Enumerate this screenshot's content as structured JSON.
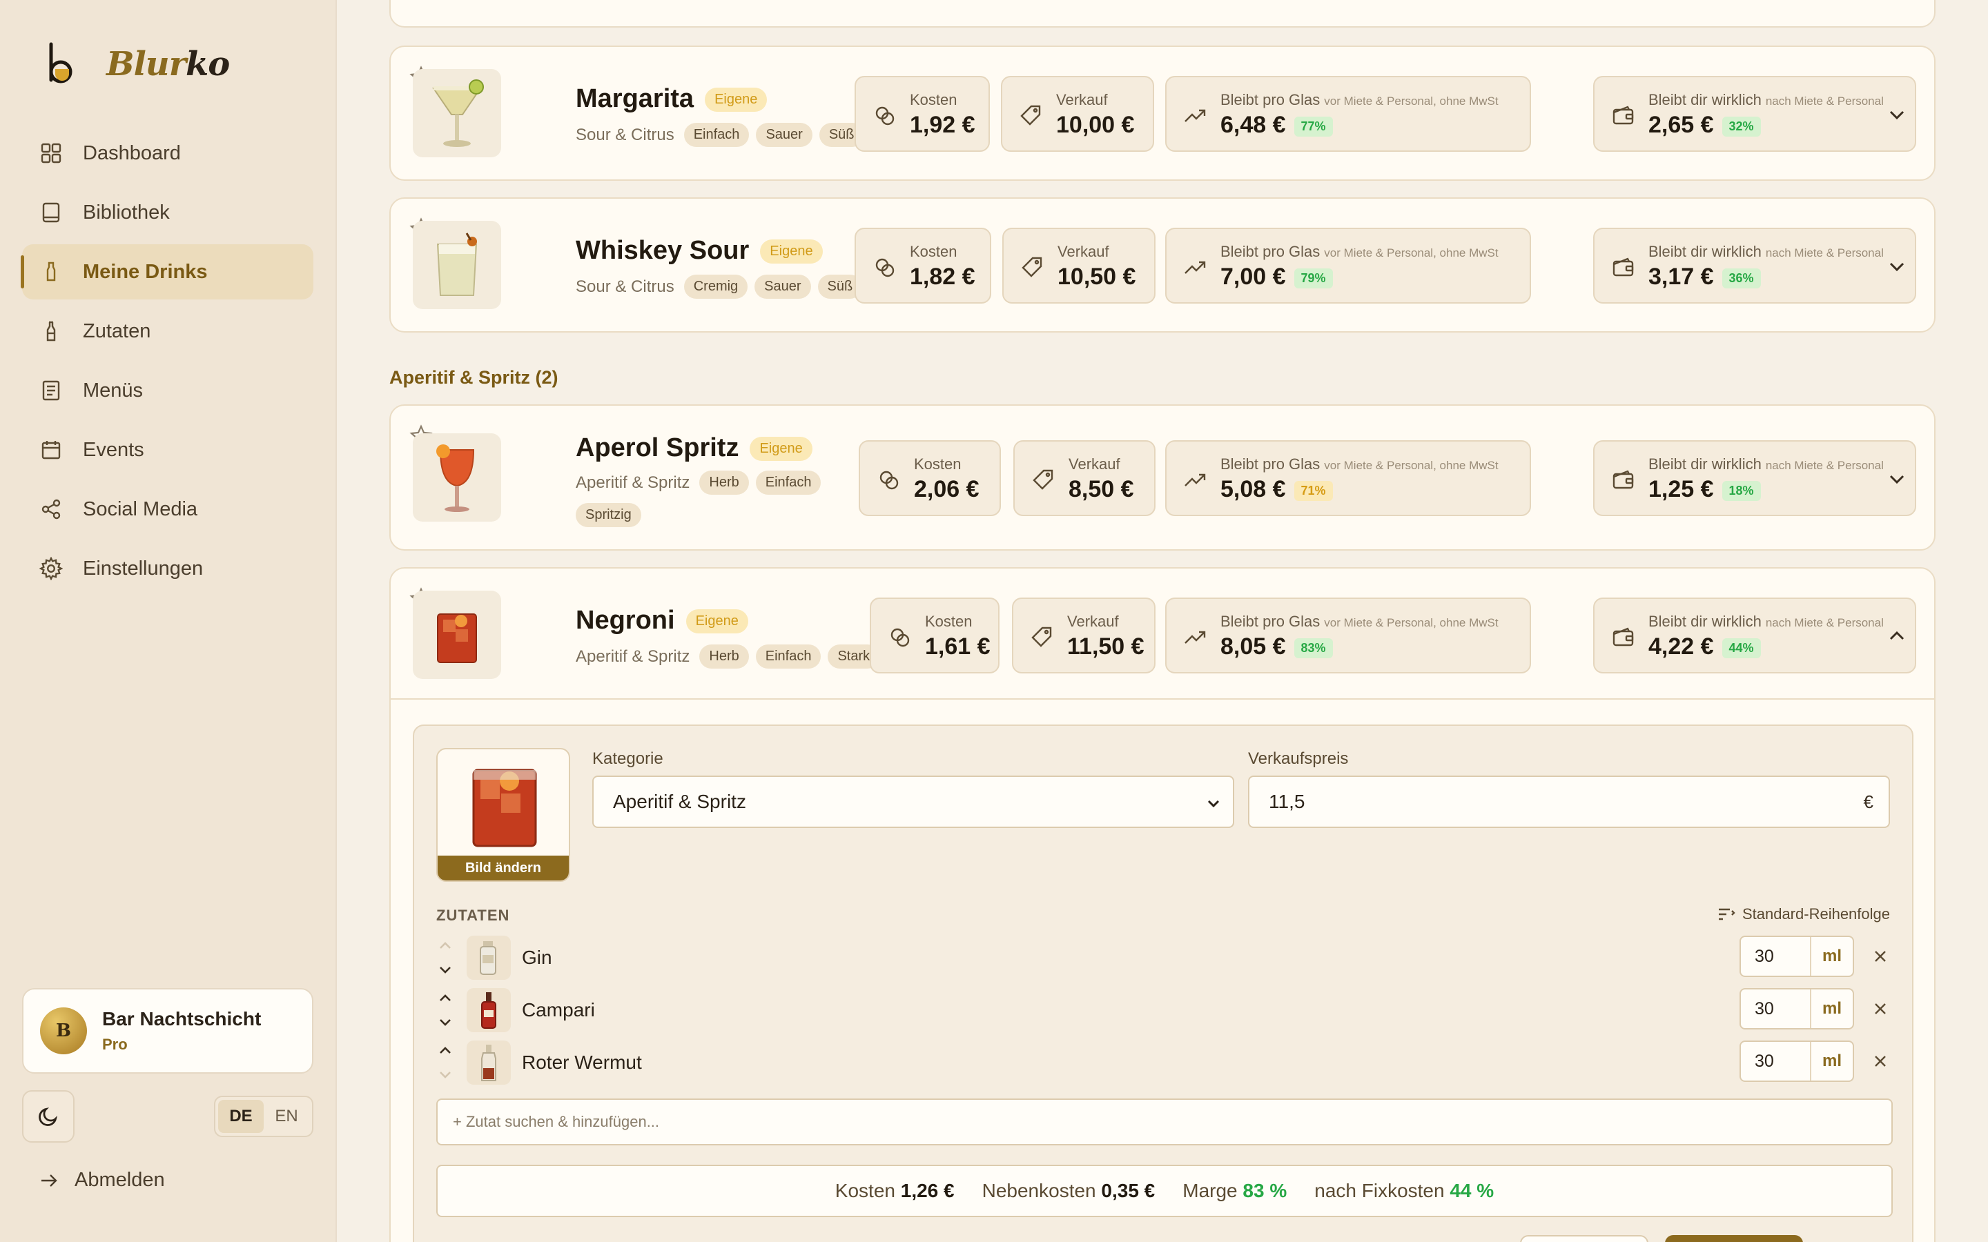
{
  "brand": {
    "name_part1": "Blur",
    "name_part2": "ko"
  },
  "nav": [
    {
      "label": "Dashboard",
      "icon": "grid-icon",
      "active": false
    },
    {
      "label": "Bibliothek",
      "icon": "book-icon",
      "active": false
    },
    {
      "label": "Meine Drinks",
      "icon": "bottle-icon",
      "active": true
    },
    {
      "label": "Zutaten",
      "icon": "flask-icon",
      "active": false
    },
    {
      "label": "Menüs",
      "icon": "menu-card-icon",
      "active": false
    },
    {
      "label": "Events",
      "icon": "calendar-icon",
      "active": false
    },
    {
      "label": "Social Media",
      "icon": "share-icon",
      "active": false
    },
    {
      "label": "Einstellungen",
      "icon": "gear-icon",
      "active": false
    }
  ],
  "user": {
    "initial": "B",
    "name": "Bar Nachtschicht",
    "plan": "Pro"
  },
  "lang": {
    "de": "DE",
    "en": "EN",
    "active": "DE"
  },
  "logout_label": "Abmelden",
  "metric_labels": {
    "kosten": "Kosten",
    "verkauf": "Verkauf",
    "bleibt_glas": "Bleibt pro Glas",
    "bleibt_glas_note": "vor Miete & Personal, ohne MwSt",
    "bleibt_wirklich": "Bleibt dir wirklich",
    "bleibt_wirklich_note": "nach Miete & Personal"
  },
  "own_badge": "Eigene",
  "section_aperitif": "Aperitif & Spritz (2)",
  "drinks": [
    {
      "name": "Margarita",
      "category": "Sour & Citrus",
      "tags": [
        "Einfach",
        "Sauer",
        "Süß"
      ],
      "kosten": "1,92 €",
      "verkauf": "10,00 €",
      "glas": "6,48 €",
      "glas_pct": "77%",
      "wirklich": "2,65 €",
      "wirklich_pct": "32%",
      "expanded": false
    },
    {
      "name": "Whiskey Sour",
      "category": "Sour & Citrus",
      "tags": [
        "Cremig",
        "Sauer",
        "Süß"
      ],
      "kosten": "1,82 €",
      "verkauf": "10,50 €",
      "glas": "7,00 €",
      "glas_pct": "79%",
      "wirklich": "3,17 €",
      "wirklich_pct": "36%",
      "expanded": false
    },
    {
      "name": "Aperol Spritz",
      "category": "Aperitif & Spritz",
      "tags": [
        "Herb",
        "Einfach",
        "Spritzig"
      ],
      "kosten": "2,06 €",
      "verkauf": "8,50 €",
      "glas": "5,08 €",
      "glas_pct": "71%",
      "wirklich": "1,25 €",
      "wirklich_pct": "18%",
      "expanded": false
    },
    {
      "name": "Negroni",
      "category": "Aperitif & Spritz",
      "tags": [
        "Herb",
        "Einfach",
        "Stark"
      ],
      "kosten": "1,61 €",
      "verkauf": "11,50 €",
      "glas": "8,05 €",
      "glas_pct": "83%",
      "wirklich": "4,22 €",
      "wirklich_pct": "44%",
      "expanded": true
    }
  ],
  "editor": {
    "change_image": "Bild ändern",
    "kategorie_label": "Kategorie",
    "kategorie_value": "Aperitif & Spritz",
    "preis_label": "Verkaufspreis",
    "preis_value": "11,5",
    "currency": "€",
    "zutaten_heading": "ZUTATEN",
    "sort_label": "Standard-Reihenfolge",
    "ingredients": [
      {
        "name": "Gin",
        "amount": "30",
        "unit": "ml"
      },
      {
        "name": "Campari",
        "amount": "30",
        "unit": "ml"
      },
      {
        "name": "Roter Wermut",
        "amount": "30",
        "unit": "ml"
      }
    ],
    "add_placeholder": "+ Zutat suchen & hinzufügen...",
    "summary": {
      "kosten_label": "Kosten",
      "kosten_value": "1,26 €",
      "neben_label": "Nebenkosten",
      "neben_value": "0,35 €",
      "marge_label": "Marge",
      "marge_value": "83 %",
      "fix_label": "nach Fixkosten",
      "fix_value": "44 %"
    }
  }
}
